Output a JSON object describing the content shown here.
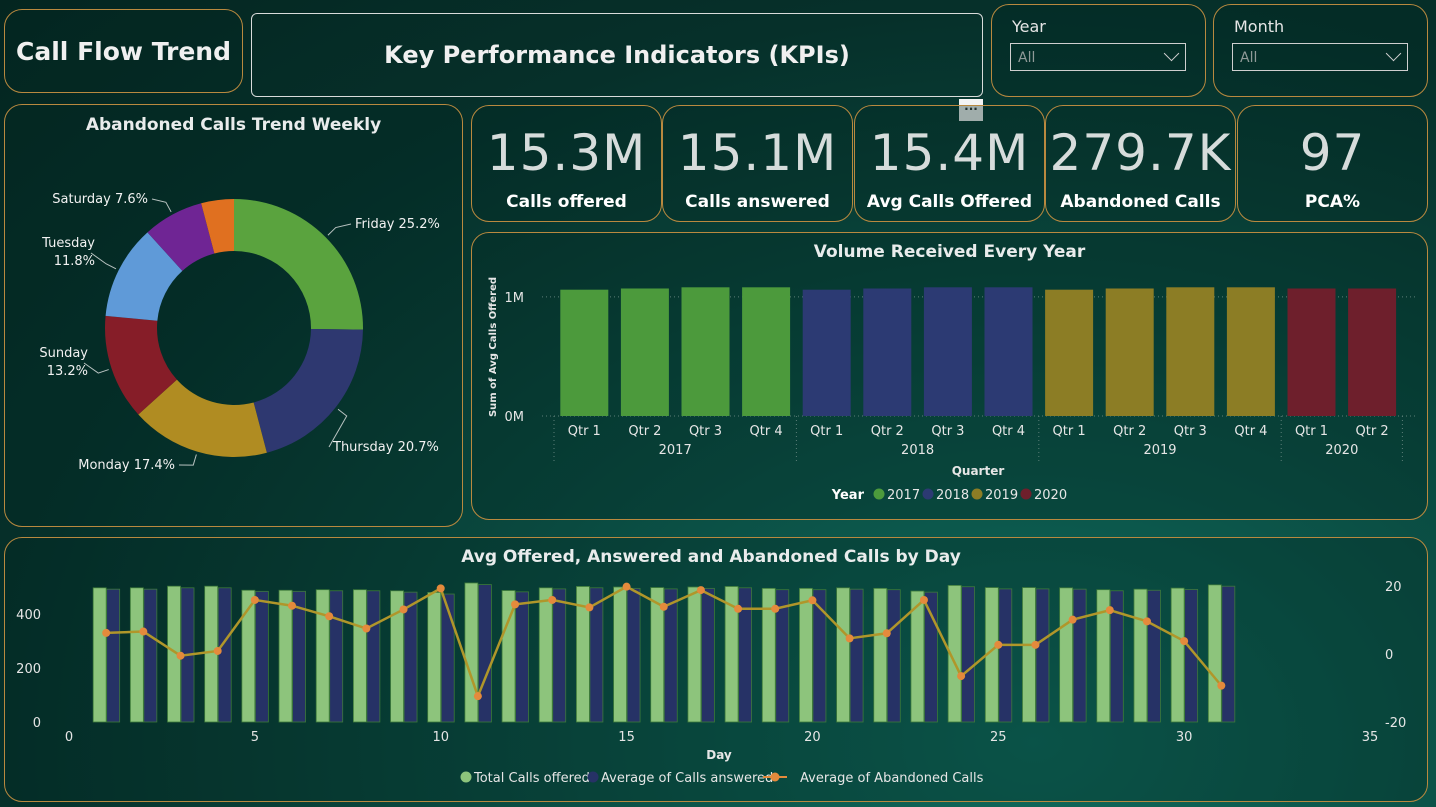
{
  "header": {
    "app_title": "Call Flow Trend",
    "kpi_title": "Key Performance Indicators (KPIs)",
    "more_options": "···"
  },
  "filters": {
    "year": {
      "label": "Year",
      "value": "All"
    },
    "month": {
      "label": "Month",
      "value": "All"
    }
  },
  "kpis": [
    {
      "value": "15.3M",
      "label": "Calls offered"
    },
    {
      "value": "15.1M",
      "label": "Calls answered"
    },
    {
      "value": "15.4M",
      "label": "Avg Calls Offered"
    },
    {
      "value": "279.7K",
      "label": "Abandoned Calls"
    },
    {
      "value": "97",
      "label": "PCA%"
    }
  ],
  "colors": {
    "border": "#b9893f",
    "y2017": "#4c9a3c",
    "y2018": "#2c3a73",
    "y2019": "#8c7d25",
    "y2020": "#6e1f2c",
    "offered": "#8dc47c",
    "answered": "#263266",
    "abandoned": "#e48a3c",
    "abandoned_line": "#b0962a"
  },
  "chart_data": [
    {
      "type": "pie",
      "title": "Abandoned Calls Trend Weekly",
      "slices": [
        {
          "name": "Friday",
          "value": 25.2,
          "label": "Friday 25.2%",
          "color": "#5aa33e"
        },
        {
          "name": "Thursday",
          "value": 20.7,
          "label": "Thursday 20.7%",
          "color": "#2e3870"
        },
        {
          "name": "Monday",
          "value": 17.4,
          "label": "Monday 17.4%",
          "color": "#b08c22"
        },
        {
          "name": "Sunday",
          "value": 13.2,
          "label": "Sunday 13.2%",
          "color": "#861d28"
        },
        {
          "name": "Tuesday",
          "value": 11.8,
          "label": "Tuesday 11.8%",
          "color": "#5f9ad8"
        },
        {
          "name": "Saturday",
          "value": 7.6,
          "label": "Saturday 7.6%",
          "color": "#6f2594"
        },
        {
          "name": "",
          "value": 4.1,
          "label": "",
          "color": "#e07020"
        }
      ]
    },
    {
      "type": "bar",
      "title": "Volume Received Every Year",
      "xlabel": "Quarter",
      "ylabel": "Sum of Avg Calls Offered",
      "yticks": [
        "0M",
        "1M"
      ],
      "ylim": [
        0,
        1.2
      ],
      "legend_title": "Year",
      "groups": [
        {
          "year": "2017",
          "quarters": [
            "Qtr 1",
            "Qtr 2",
            "Qtr 3",
            "Qtr 4"
          ],
          "values": [
            1.06,
            1.07,
            1.08,
            1.08
          ]
        },
        {
          "year": "2018",
          "quarters": [
            "Qtr 1",
            "Qtr 2",
            "Qtr 3",
            "Qtr 4"
          ],
          "values": [
            1.06,
            1.07,
            1.08,
            1.08
          ]
        },
        {
          "year": "2019",
          "quarters": [
            "Qtr 1",
            "Qtr 2",
            "Qtr 3",
            "Qtr 4"
          ],
          "values": [
            1.06,
            1.07,
            1.08,
            1.08
          ]
        },
        {
          "year": "2020",
          "quarters": [
            "Qtr 1",
            "Qtr 2"
          ],
          "values": [
            1.07,
            1.07
          ]
        }
      ]
    },
    {
      "type": "bar",
      "title": "Avg Offered, Answered and Abandoned Calls by Day",
      "xlabel": "Day",
      "xticks": [
        0,
        5,
        10,
        15,
        20,
        25,
        30,
        35
      ],
      "xlim": [
        0,
        35
      ],
      "yticks_left": [
        0,
        200,
        400
      ],
      "ylim_left": [
        0,
        600
      ],
      "yticks_right": [
        -20,
        0,
        20
      ],
      "ylim_right": [
        -20,
        20
      ],
      "x": [
        1,
        2,
        3,
        4,
        5,
        6,
        7,
        8,
        9,
        10,
        11,
        12,
        13,
        14,
        15,
        16,
        17,
        18,
        19,
        20,
        21,
        22,
        23,
        24,
        25,
        26,
        27,
        28,
        29,
        30,
        31
      ],
      "series": [
        {
          "name": "Total Calls offered",
          "axis": "left",
          "values": [
            497,
            497,
            503,
            503,
            488,
            488,
            490,
            490,
            486,
            480,
            515,
            487,
            497,
            502,
            500,
            498,
            500,
            502,
            495,
            495,
            497,
            495,
            485,
            506,
            498,
            498,
            497,
            490,
            492,
            496,
            508
          ]
        },
        {
          "name": "Average of Calls answered",
          "axis": "left",
          "values": [
            492,
            492,
            497,
            497,
            484,
            484,
            486,
            486,
            481,
            474,
            509,
            482,
            493,
            497,
            495,
            493,
            495,
            497,
            490,
            490,
            492,
            490,
            481,
            501,
            493,
            493,
            492,
            486,
            488,
            491,
            503
          ]
        },
        {
          "name": "Average of Abandoned Calls",
          "axis": "right",
          "values": [
            6.2,
            6.6,
            -0.5,
            0.9,
            15.9,
            14.2,
            11.1,
            7.5,
            13.1,
            19.3,
            -12.4,
            14.6,
            15.9,
            13.7,
            19.8,
            13.9,
            18.8,
            13.3,
            13.3,
            15.8,
            4.6,
            6.1,
            15.9,
            -6.5,
            2.7,
            2.7,
            10.1,
            12.9,
            9.6,
            3.8,
            -9.3
          ]
        }
      ]
    }
  ]
}
